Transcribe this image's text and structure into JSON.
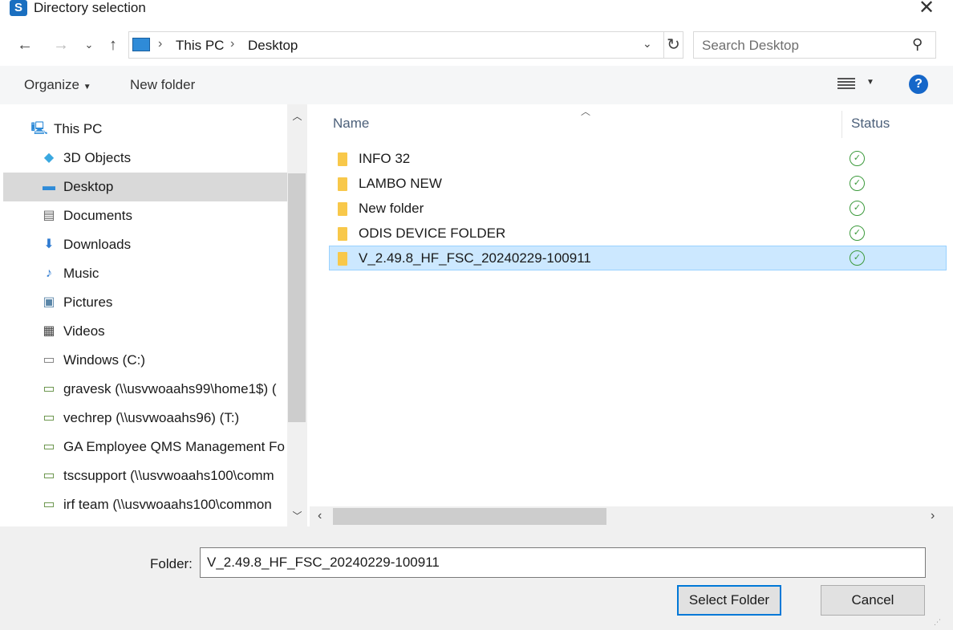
{
  "window": {
    "title": "Directory selection",
    "app_icon_letter": "S"
  },
  "address_bar": {
    "crumbs": [
      "This PC",
      "Desktop"
    ]
  },
  "search": {
    "placeholder": "Search Desktop"
  },
  "toolbar": {
    "organize_label": "Organize",
    "new_folder_label": "New folder",
    "help_label": "?"
  },
  "sidebar": {
    "items": [
      {
        "label": "This PC",
        "icon": "computer-icon"
      },
      {
        "label": "3D Objects",
        "icon": "cube-icon"
      },
      {
        "label": "Desktop",
        "icon": "desktop-icon",
        "selected": true
      },
      {
        "label": "Documents",
        "icon": "document-icon"
      },
      {
        "label": "Downloads",
        "icon": "download-arrow-icon"
      },
      {
        "label": "Music",
        "icon": "music-note-icon"
      },
      {
        "label": "Pictures",
        "icon": "picture-icon"
      },
      {
        "label": "Videos",
        "icon": "film-icon"
      },
      {
        "label": "Windows (C:)",
        "icon": "drive-icon"
      },
      {
        "label": "gravesk (\\\\usvwoaahs99\\home1$) (",
        "icon": "network-drive-icon"
      },
      {
        "label": "vechrep (\\\\usvwoaahs96) (T:)",
        "icon": "network-drive-icon"
      },
      {
        "label": "GA Employee QMS Management Fo",
        "icon": "network-drive-icon"
      },
      {
        "label": "tscsupport (\\\\usvwoaahs100\\comm",
        "icon": "network-drive-icon"
      },
      {
        "label": "irf team (\\\\usvwoaahs100\\common",
        "icon": "network-drive-icon"
      }
    ]
  },
  "file_list": {
    "columns": [
      "Name",
      "Status"
    ],
    "rows": [
      {
        "name": "INFO 32",
        "status": "synced"
      },
      {
        "name": "LAMBO NEW",
        "status": "synced"
      },
      {
        "name": "New folder",
        "status": "synced"
      },
      {
        "name": "ODIS DEVICE FOLDER",
        "status": "synced"
      },
      {
        "name": "V_2.49.8_HF_FSC_20240229-100911",
        "status": "synced",
        "selected": true
      }
    ]
  },
  "footer": {
    "folder_label": "Folder:",
    "folder_value": "V_2.49.8_HF_FSC_20240229-100911",
    "select_button": "Select Folder",
    "cancel_button": "Cancel"
  },
  "colors": {
    "selection_bg": "#cce8ff",
    "selection_border": "#99d1ff",
    "accent": "#0078d7",
    "folder": "#f8c84a",
    "status_ok": "#3c9a3c"
  }
}
